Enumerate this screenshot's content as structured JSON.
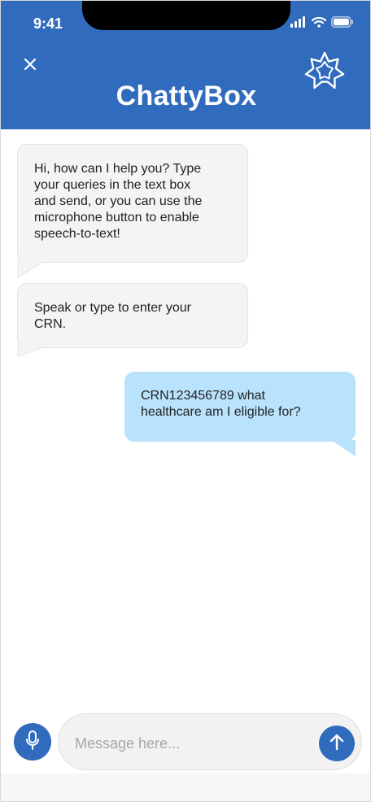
{
  "status_bar": {
    "time": "9:41"
  },
  "header": {
    "title": "ChattyBox"
  },
  "messages": [
    {
      "sender": "bot",
      "text": "Hi, how can I help you? Type\nyour queries in the text box\nand send, or you can use the\nmicrophone button to enable\nspeech-to-text!"
    },
    {
      "sender": "bot",
      "text": "Speak or type to enter your\nCRN."
    },
    {
      "sender": "user",
      "text": "CRN123456789 what\nhealthcare am I eligible for?"
    }
  ],
  "composer": {
    "placeholder": "Message here...",
    "value": ""
  },
  "colors": {
    "brand": "#316bbd",
    "bot_bubble": "#f4f4f4",
    "user_bubble": "#b9e2fc"
  },
  "icons": [
    "signal-icon",
    "wifi-icon",
    "battery-icon",
    "close-icon",
    "starburst-logo-icon",
    "microphone-icon",
    "send-arrow-icon"
  ]
}
